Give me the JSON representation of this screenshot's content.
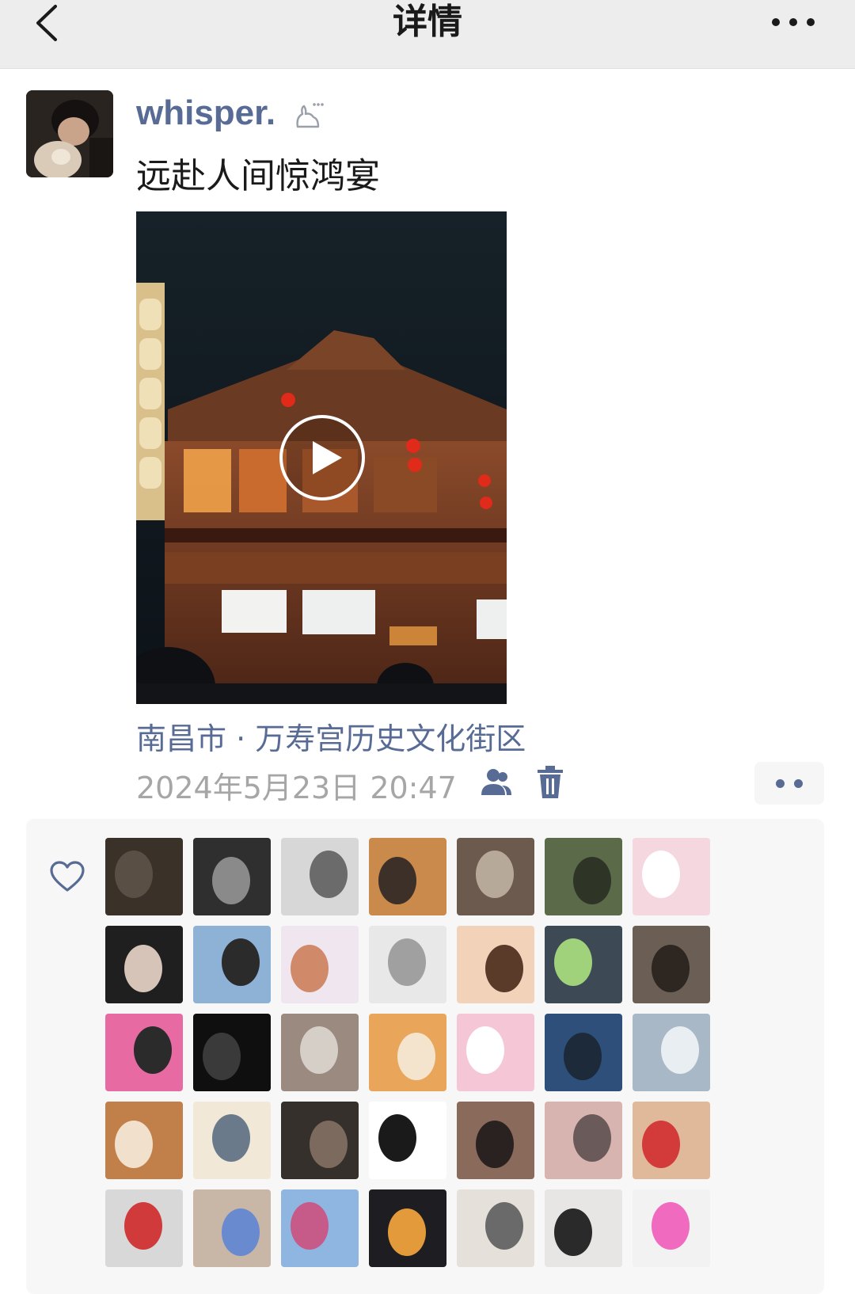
{
  "nav": {
    "title": "详情",
    "back_icon": "chevron-left-icon",
    "more_icon": "more-horizontal-icon"
  },
  "post": {
    "username": "whisper.",
    "text": "远赴人间惊鸿宴",
    "location": "南昌市 · 万寿宫历史文化街区",
    "timestamp": "2024年5月23日 20:47",
    "video_icon": "play-icon"
  },
  "icons": {
    "status": "bunny-status-icon",
    "privacy": "friends-visibility-icon",
    "delete": "trash-icon",
    "action": "comment-like-menu-icon",
    "like": "heart-outline-icon"
  },
  "colors": {
    "link": "#576b95",
    "muted": "#a6a6a6",
    "nav_bg": "#ededed"
  },
  "likes": {
    "rows": 5,
    "avatars": [
      [
        "#3a3128",
        "#5a4f44"
      ],
      [
        "#2f2f2f",
        "#8a8a8a"
      ],
      [
        "#d7d7d7",
        "#6b6b6b"
      ],
      [
        "#c98a4c",
        "#3c3029"
      ],
      [
        "#6d5a4e",
        "#b7a99a"
      ],
      [
        "#5b6b4a",
        "#2f3526"
      ],
      [
        "#f5d7e0",
        "#ffffff"
      ],
      [
        "#1f1f1f",
        "#d6c4b8"
      ],
      [
        "#8eb2d6",
        "#2b2b2b"
      ],
      [
        "#f0e6f0",
        "#d08a6a"
      ],
      [
        "#e8e8e8",
        "#a0a0a0"
      ],
      [
        "#f2d2b8",
        "#5a3b2a"
      ],
      [
        "#3d4a55",
        "#9fd27b"
      ],
      [
        "#6b5e55",
        "#2d2621"
      ],
      [
        "#e86aa2",
        "#2b2b2b"
      ],
      [
        "#0f0f0f",
        "#3a3a3a"
      ],
      [
        "#9b8a7f",
        "#d6cfc7"
      ],
      [
        "#e9a55a",
        "#f4e3cd"
      ],
      [
        "#f4c6d6",
        "#ffffff"
      ],
      [
        "#2d4f7a",
        "#1c2a3a"
      ],
      [
        "#a9b8c6",
        "#e9eef2"
      ],
      [
        "#c17f4a",
        "#f0e0cc"
      ],
      [
        "#f1e8d8",
        "#6a7a8a"
      ],
      [
        "#35302c",
        "#7b6a5d"
      ],
      [
        "#ffffff",
        "#1a1a1a"
      ],
      [
        "#8a6a5a",
        "#2a2220"
      ],
      [
        "#d8b4b0",
        "#6a5a5a"
      ],
      [
        "#e0b89a",
        "#d33a3a"
      ],
      [
        "#d8d8d8",
        "#d13a3a"
      ],
      [
        "#c8b6a6",
        "#6a8ad0"
      ],
      [
        "#8fb6e0",
        "#c65b8a"
      ],
      [
        "#1d1d22",
        "#e39a3a"
      ],
      [
        "#e6e0da",
        "#6a6a6a"
      ],
      [
        "#e8e6e4",
        "#2a2a2a"
      ],
      [
        "#f2f2f2",
        "#f06ac0"
      ]
    ]
  }
}
